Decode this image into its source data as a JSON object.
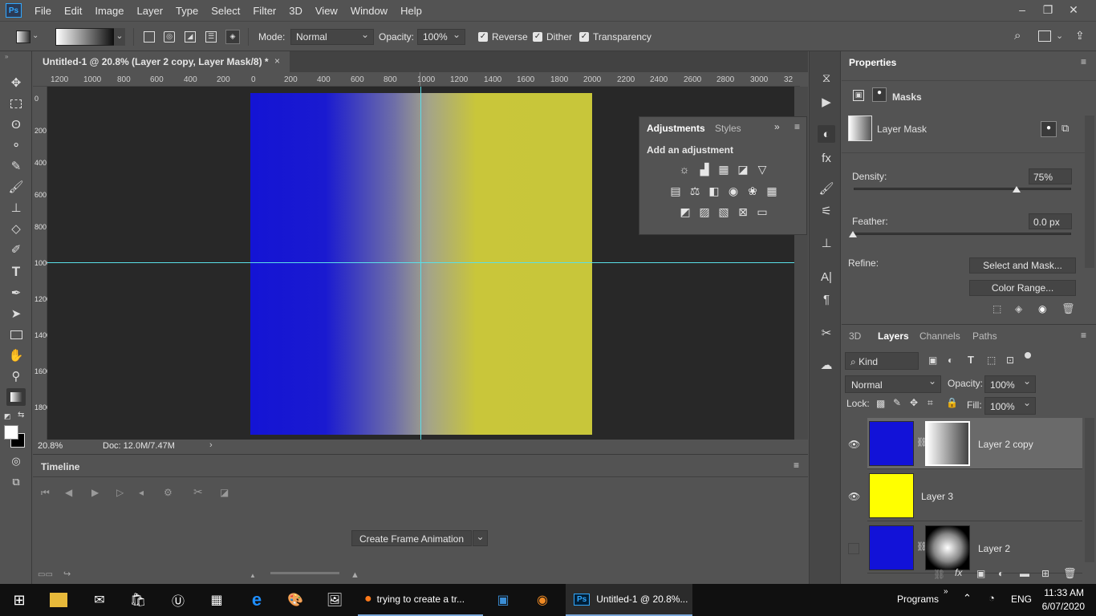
{
  "menubar": {
    "logo": "Ps",
    "items": [
      "File",
      "Edit",
      "Image",
      "Layer",
      "Type",
      "Select",
      "Filter",
      "3D",
      "View",
      "Window",
      "Help"
    ],
    "window_controls": [
      "–",
      "❐",
      "✕"
    ]
  },
  "options": {
    "mode_label": "Mode:",
    "mode_value": "Normal",
    "opacity_label": "Opacity:",
    "opacity_value": "100%",
    "reverse": "Reverse",
    "dither": "Dither",
    "transparency": "Transparency"
  },
  "document": {
    "tab_title": "Untitled-1 @ 20.8% (Layer 2 copy, Layer Mask/8) *",
    "close": "×",
    "zoom": "20.8%",
    "doc_info": "Doc: 12.0M/7.47M"
  },
  "ruler": {
    "h_labels": [
      "1200",
      "1000",
      "800",
      "600",
      "400",
      "200",
      "0",
      "200",
      "400",
      "600",
      "800",
      "1000",
      "1200",
      "1400",
      "1600",
      "1800",
      "2000",
      "2200",
      "2400",
      "2600",
      "2800",
      "3000",
      "32"
    ],
    "v_labels": [
      "0",
      "200",
      "400",
      "600",
      "800",
      "1000",
      "1200",
      "1400",
      "1600",
      "1800"
    ]
  },
  "adjustments": {
    "tab_active": "Adjustments",
    "tab_other": "Styles",
    "heading": "Add an adjustment"
  },
  "timeline": {
    "title": "Timeline",
    "create_button": "Create Frame Animation"
  },
  "properties": {
    "title": "Properties",
    "section": "Masks",
    "mask_label": "Layer Mask",
    "density_label": "Density:",
    "density_value": "75%",
    "density_level": 0.75,
    "feather_label": "Feather:",
    "feather_value": "0.0 px",
    "refine_label": "Refine:",
    "select_mask_button": "Select and Mask...",
    "color_range_button": "Color Range..."
  },
  "layers_panel": {
    "tabs": [
      "3D",
      "Layers",
      "Channels",
      "Paths"
    ],
    "kind": "Kind",
    "blend_mode": "Normal",
    "opacity_label": "Opacity:",
    "opacity_value": "100%",
    "lock_label": "Lock:",
    "fill_label": "Fill:",
    "fill_value": "100%",
    "layers": [
      {
        "name": "Layer 2 copy",
        "visible": true,
        "selected": true,
        "color": "#1212d8",
        "has_mask": true
      },
      {
        "name": "Layer 3",
        "visible": true,
        "selected": false,
        "color": "#ffff00",
        "has_mask": false
      },
      {
        "name": "Layer 2",
        "visible": false,
        "selected": false,
        "color": "#1212d8",
        "has_mask": true
      }
    ]
  },
  "taskbar": {
    "firefox_label": "trying to create a tr...",
    "ps_label": "Untitled-1 @ 20.8%...",
    "programs": "Programs",
    "lang": "ENG",
    "time": "11:33 AM",
    "date": "6/07/2020"
  }
}
